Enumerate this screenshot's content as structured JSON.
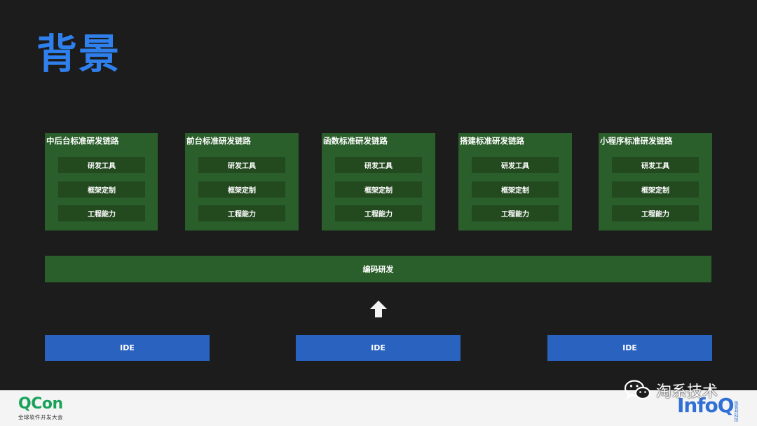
{
  "slide": {
    "title": "背景",
    "chains": [
      {
        "title": "中后台标准研发链路",
        "items": [
          "研发工具",
          "框架定制",
          "工程能力"
        ]
      },
      {
        "title": "前台标准研发链路",
        "items": [
          "研发工具",
          "框架定制",
          "工程能力"
        ]
      },
      {
        "title": "函数标准研发链路",
        "items": [
          "研发工具",
          "框架定制",
          "工程能力"
        ]
      },
      {
        "title": "搭建标准研发链路",
        "items": [
          "研发工具",
          "框架定制",
          "工程能力"
        ]
      },
      {
        "title": "小程序标准研发链路",
        "items": [
          "研发工具",
          "框架定制",
          "工程能力"
        ]
      }
    ],
    "coding_bar": "编码研发",
    "ide_boxes": [
      "IDE",
      "IDE",
      "IDE"
    ]
  },
  "footer": {
    "qcon_logo": "QCon",
    "qcon_subtitle": "全球软件开发大会",
    "infoq_logo": "InfoQ",
    "infoq_sub": "极客邦科技"
  },
  "watermark": {
    "text": "淘系技术",
    "icon": "wechat-icon"
  },
  "colors": {
    "background": "#1c1c1c",
    "title": "#2f80ed",
    "chain_box": "#2a5e2a",
    "chain_item": "#23491f",
    "ide_box": "#2a62c0",
    "qcon_green": "#19a35a",
    "infoq_blue": "#2f6fd6"
  }
}
